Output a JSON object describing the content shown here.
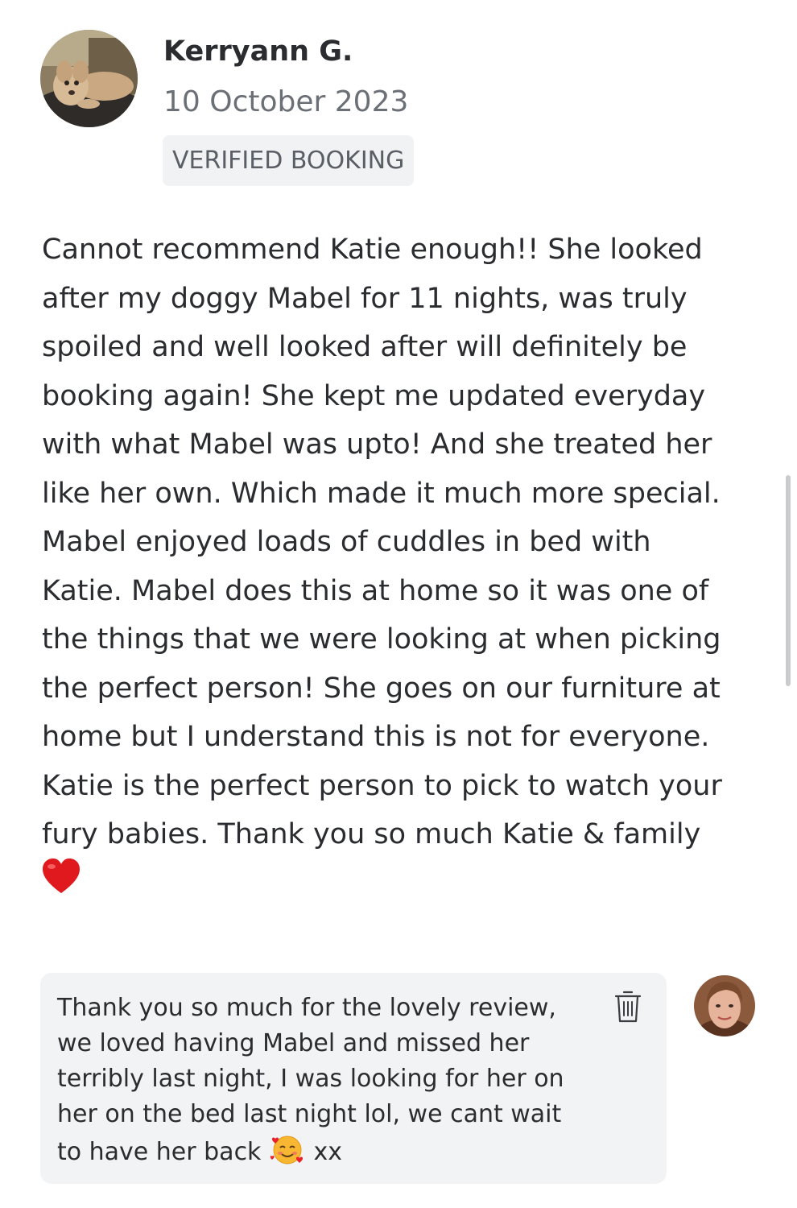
{
  "review": {
    "author": "Kerryann G.",
    "date": "10 October 2023",
    "badge": "VERIFIED BOOKING",
    "text": "Cannot recommend Katie enough!! She looked\nafter my doggy Mabel for 11 nights, was truly\nspoiled and well looked after will definitely be\nbooking again! She kept me updated everyday\nwith what Mabel was upto! And she treated her\nlike her own. Which made it much more special.\nMabel enjoyed loads of cuddles in bed with\nKatie. Mabel does this at home so it was one of\nthe things that we were looking at when picking\nthe perfect person! She goes on our furniture at\nhome but I understand this is not for everyone.\nKatie is the perfect person to pick to watch your\nfury babies. Thank you so much Katie & family",
    "end_emoji": "red-heart-icon"
  },
  "reply": {
    "text_main": "Thank you so much for the lovely review,\nwe loved having Mabel and missed her\nterribly last night, I was looking for her on\nher on the bed last night lol, we cant wait\nto have her back",
    "text_suffix": "xx",
    "inline_emoji": "smiling-face-with-hearts-icon",
    "delete_icon": "trash-icon"
  },
  "colors": {
    "text": "#2a2c2f",
    "muted": "#6b6f76",
    "badge_bg": "#f1f2f4",
    "bubble_bg": "#f2f3f5",
    "heart": "#e0191e"
  }
}
